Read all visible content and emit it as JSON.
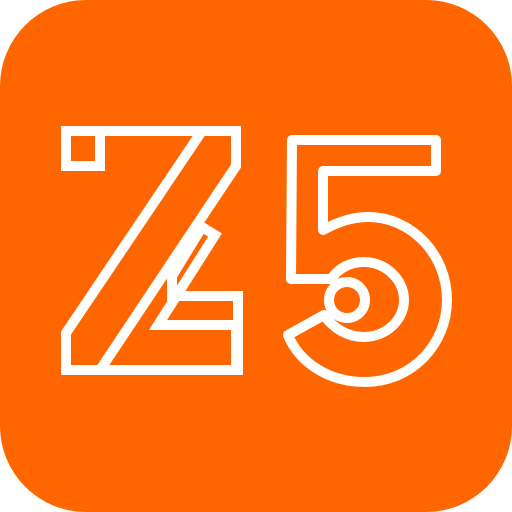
{
  "app_icon": {
    "logo_text": "Z5",
    "background_color": "#ff6600",
    "glyph_color": "#ffffff"
  }
}
